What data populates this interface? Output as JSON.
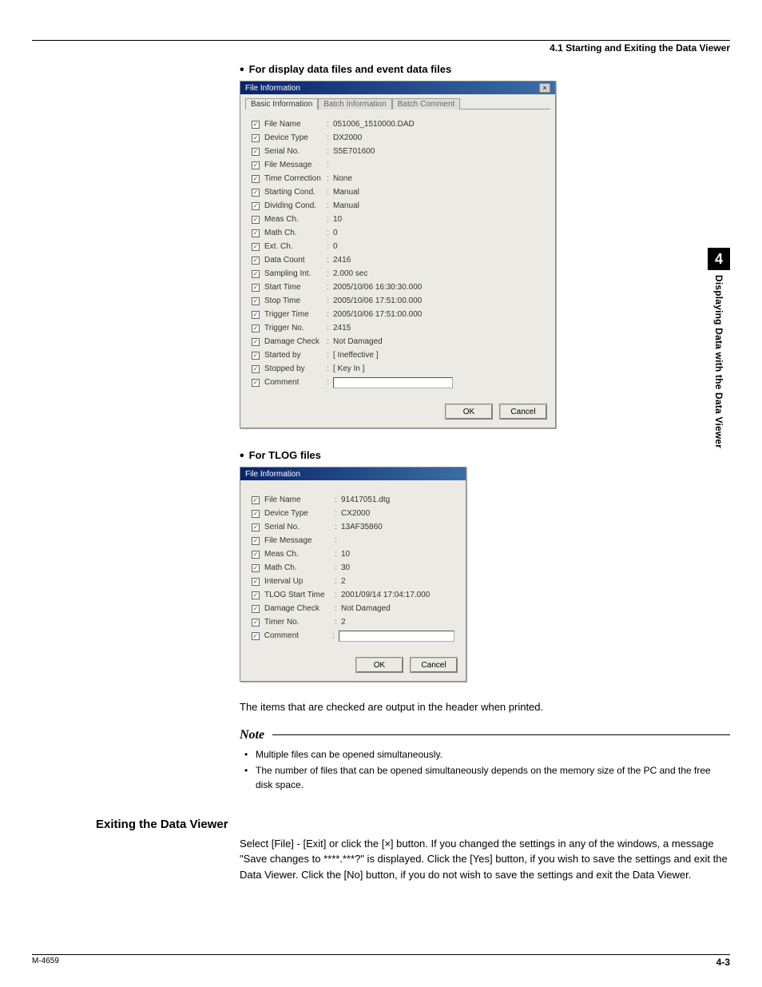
{
  "header": {
    "section": "4.1  Starting and Exiting the Data Viewer"
  },
  "sidebar": {
    "chapter": "4",
    "title": "Displaying Data with the Data Viewer"
  },
  "bullets": {
    "b1": "For display data files and event data files",
    "b2": "For TLOG files"
  },
  "dialog1": {
    "title": "File Information",
    "tabs": {
      "t1": "Basic Information",
      "t2": "Batch Information",
      "t3": "Batch Comment"
    },
    "fields": [
      {
        "label": "File Name",
        "value": "051006_1510000.DAD"
      },
      {
        "label": "Device Type",
        "value": "DX2000"
      },
      {
        "label": "Serial No.",
        "value": "S5E701600"
      },
      {
        "label": "File Message",
        "value": ""
      },
      {
        "label": "Time Correction",
        "value": "None"
      },
      {
        "label": "Starting Cond.",
        "value": "Manual"
      },
      {
        "label": "Dividing Cond.",
        "value": "Manual"
      },
      {
        "label": "Meas Ch.",
        "value": "10"
      },
      {
        "label": "Math Ch.",
        "value": "0"
      },
      {
        "label": "Ext. Ch.",
        "value": "0"
      },
      {
        "label": "Data Count",
        "value": "2416"
      },
      {
        "label": "Sampling Int.",
        "value": "2.000 sec"
      },
      {
        "label": "Start Time",
        "value": "2005/10/06 16:30:30.000"
      },
      {
        "label": "Stop Time",
        "value": "2005/10/06 17:51:00.000"
      },
      {
        "label": "Trigger Time",
        "value": "2005/10/06 17:51:00.000"
      },
      {
        "label": "Trigger No.",
        "value": "2415"
      },
      {
        "label": "Damage Check",
        "value": "Not Damaged"
      },
      {
        "label": "Started by",
        "value": "[ Ineffective ]"
      },
      {
        "label": "Stopped by",
        "value": "[ Key In ]"
      },
      {
        "label": "Comment",
        "value": ""
      }
    ],
    "buttons": {
      "ok": "OK",
      "cancel": "Cancel"
    }
  },
  "dialog2": {
    "title": "File Information",
    "fields": [
      {
        "label": "File Name",
        "value": "91417051.dtg"
      },
      {
        "label": "Device Type",
        "value": "CX2000"
      },
      {
        "label": "Serial No.",
        "value": "13AF35860"
      },
      {
        "label": "File Message",
        "value": ""
      },
      {
        "label": "Meas Ch.",
        "value": "10"
      },
      {
        "label": "Math Ch.",
        "value": "30"
      },
      {
        "label": "Interval Up",
        "value": "2"
      },
      {
        "label": "TLOG Start Time",
        "value": "2001/09/14 17:04:17.000"
      },
      {
        "label": "Damage Check",
        "value": "Not Damaged"
      },
      {
        "label": "Timer No.",
        "value": "2"
      },
      {
        "label": "Comment",
        "value": ""
      }
    ],
    "buttons": {
      "ok": "OK",
      "cancel": "Cancel"
    }
  },
  "para": {
    "printed": "The items that are checked are output in the header when printed."
  },
  "note": {
    "title": "Note",
    "items": [
      "Multiple files can be opened simultaneously.",
      "The number of files that can be opened simultaneously depends on the memory size of the PC and the free disk space."
    ]
  },
  "section2": {
    "title": "Exiting the Data Viewer",
    "body": "Select [File] - [Exit] or click the [×] button.  If you changed the settings in any of the windows, a message \"Save changes to ****.***?\" is displayed.  Click the [Yes] button, if you wish to save the settings and exit the Data Viewer.  Click the [No] button, if you do not wish to save the settings and exit the Data Viewer."
  },
  "footer": {
    "left": "M-4659",
    "right": "4-3"
  }
}
